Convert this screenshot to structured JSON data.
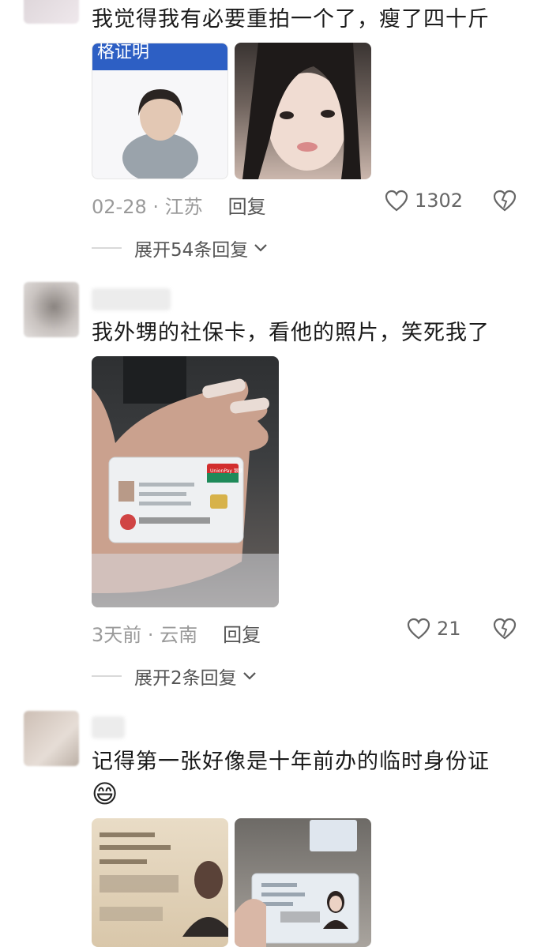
{
  "comments": [
    {
      "text": "我觉得我有必要重拍一个了，瘦了四十斤",
      "date_location": "02-28 · 江苏",
      "reply_label": "回复",
      "likes": "1302",
      "expand_label": "展开54条回复",
      "photo1_banner": "格证明"
    },
    {
      "text": "我外甥的社保卡，看他的照片，笑死我了",
      "date_location": "3天前 · 云南",
      "reply_label": "回复",
      "likes": "21",
      "expand_label": "展开2条回复",
      "card_brand": "UnionPay 银联"
    },
    {
      "text": "记得第一张好像是十年前办的临时身份证",
      "emoji": "😄"
    }
  ],
  "colors": {
    "text": "#1a1a1a",
    "meta": "#9a9a9a",
    "banner_blue": "#2d5fc4"
  }
}
